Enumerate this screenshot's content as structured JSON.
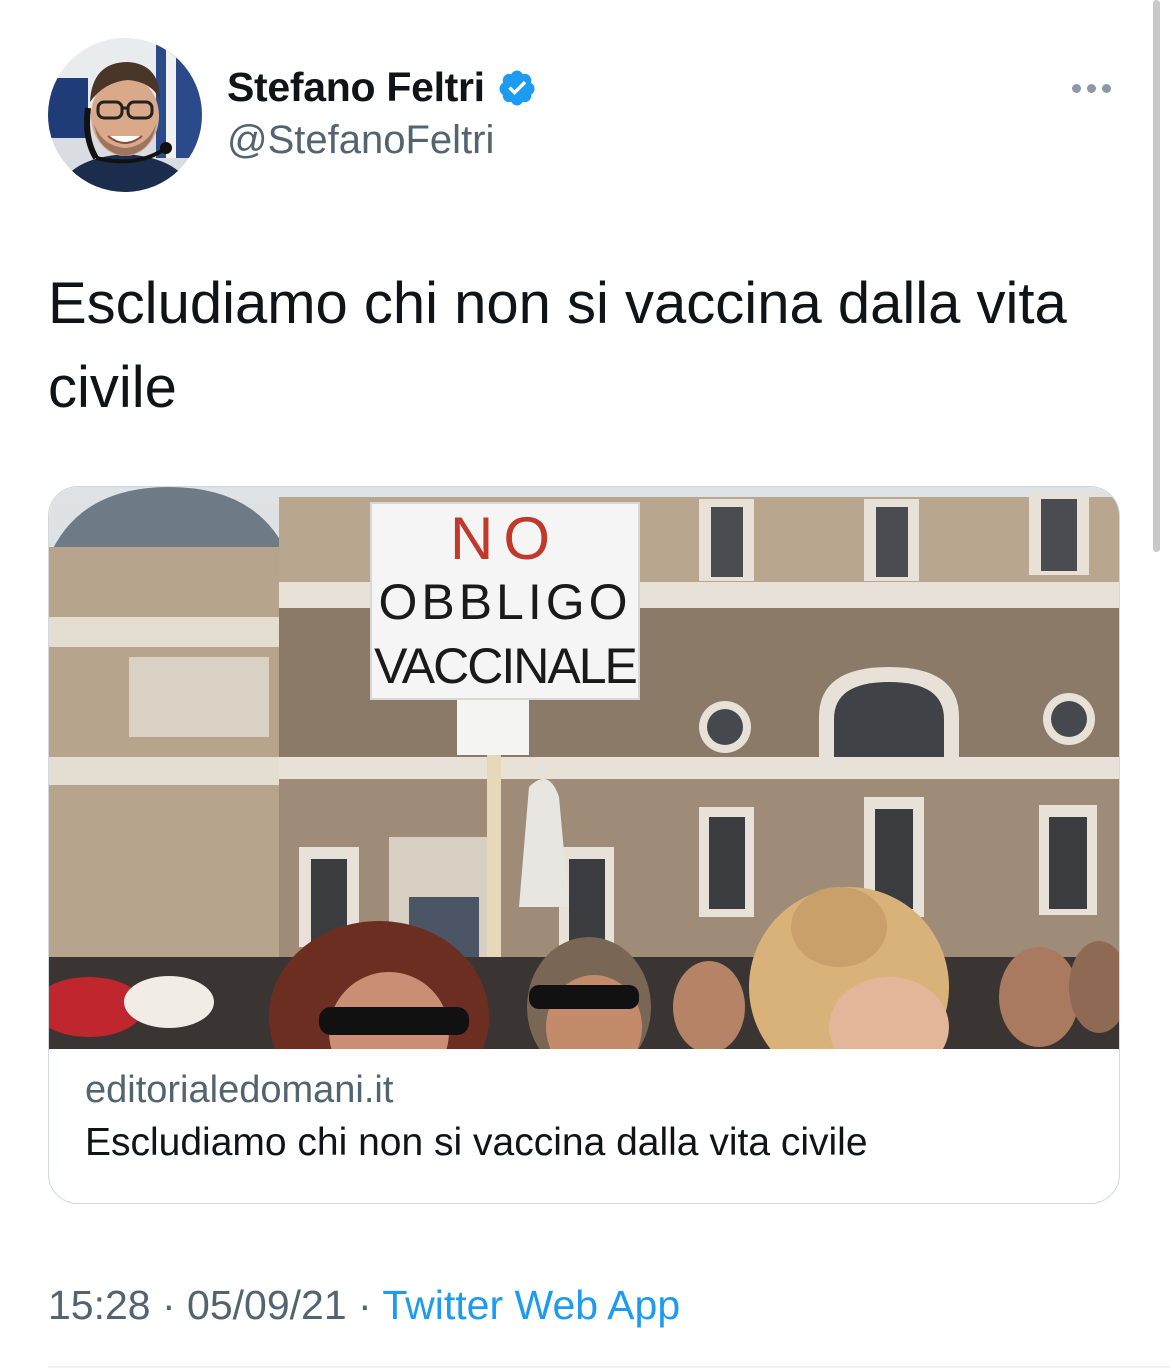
{
  "author": {
    "display_name": "Stefano Feltri",
    "handle": "@StefanoFeltri",
    "verified_icon": "verified-badge-icon",
    "avatar_icon": "profile-photo"
  },
  "tweet": {
    "text": "Escludiamo chi non si vaccina dalla vita civile"
  },
  "card": {
    "sign_line1": "NO",
    "sign_line2": "OBBLIGO",
    "sign_line3": "VACCINALE",
    "domain": "editorialedomani.it",
    "title": "Escludiamo chi non si vaccina dalla vita civile"
  },
  "meta": {
    "time": "15:28",
    "separator": " · ",
    "date": "05/09/21",
    "source": "Twitter Web App"
  },
  "colors": {
    "accent": "#1d9bf0",
    "secondary_text": "#536471",
    "border": "#cfd9de"
  }
}
